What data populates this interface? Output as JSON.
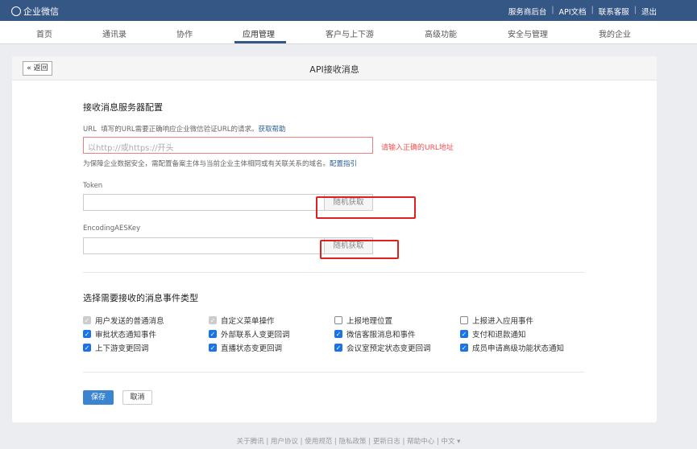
{
  "topbar": {
    "logo": "企业微信",
    "links": [
      "服务商后台",
      "API文档",
      "联系客服",
      "退出"
    ]
  },
  "nav": [
    "首页",
    "通讯录",
    "协作",
    "应用管理",
    "客户与上下游",
    "高级功能",
    "安全与管理",
    "我的企业"
  ],
  "page": {
    "back": "返回",
    "title": "API接收消息"
  },
  "server": {
    "heading": "接收消息服务器配置",
    "url_label": "URL",
    "url_hint": "填写的URL需要正确响应企业微信验证URL的请求。",
    "url_help": "获取帮助",
    "url_placeholder": "以http://或https://开头",
    "url_error": "请输入正确的URL地址",
    "domain_note": "为保障企业数据安全，需配置备案主体与当前企业主体相同或有关联关系的域名。",
    "domain_link": "配置指引",
    "token_label": "Token",
    "token_value": "",
    "aes_label": "EncodingAESKey",
    "aes_value": "",
    "random": "随机获取"
  },
  "events": {
    "heading": "选择需要接收的消息事件类型",
    "items": [
      {
        "label": "用户发送的普通消息",
        "state": "disabled"
      },
      {
        "label": "自定义菜单操作",
        "state": "disabled"
      },
      {
        "label": "上报地理位置",
        "state": "off"
      },
      {
        "label": "上报进入应用事件",
        "state": "off"
      },
      {
        "label": "审批状态通知事件",
        "state": "on"
      },
      {
        "label": "外部联系人变更回调",
        "state": "on"
      },
      {
        "label": "微信客服消息和事件",
        "state": "on"
      },
      {
        "label": "支付和退款通知",
        "state": "on"
      },
      {
        "label": "上下游变更回调",
        "state": "on"
      },
      {
        "label": "直播状态变更回调",
        "state": "on"
      },
      {
        "label": "会议室预定状态变更回调",
        "state": "on"
      },
      {
        "label": "成员申请高级功能状态通知",
        "state": "on"
      }
    ]
  },
  "actions": {
    "save": "保存",
    "cancel": "取消"
  },
  "footer": [
    "关于腾讯",
    "用户协议",
    "使用规范",
    "隐私政策",
    "更新日志",
    "帮助中心",
    "中文 ▾"
  ]
}
